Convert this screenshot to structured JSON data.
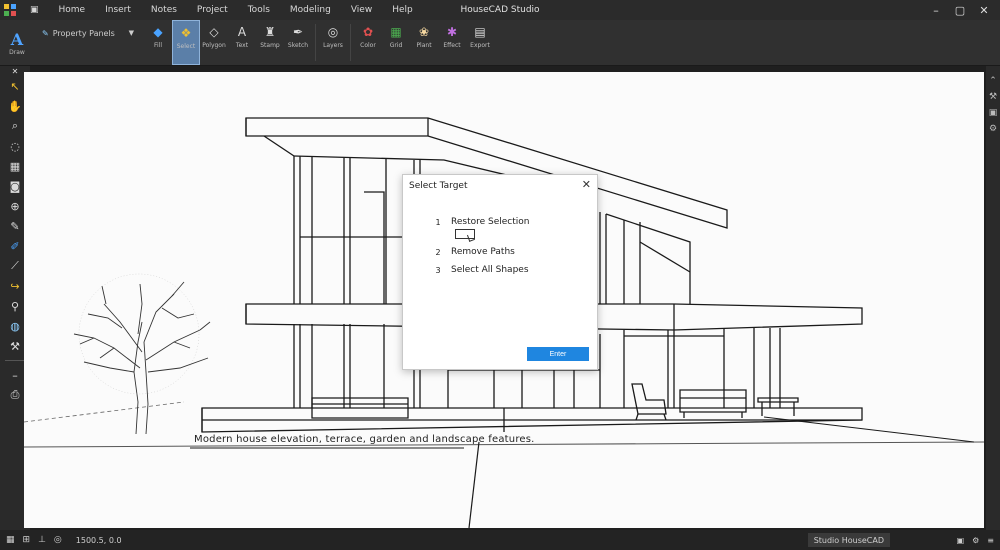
{
  "titlebar": {
    "title": "HouseCAD Studio",
    "menus": [
      "Home",
      "Insert",
      "Notes",
      "Project",
      "Tools",
      "Modeling",
      "View",
      "Help"
    ]
  },
  "ribbon": {
    "left_label": "Draw",
    "dropdown_label": "Property Panels",
    "tools": [
      {
        "icon": "paint-bucket-icon",
        "label": "Fill"
      },
      {
        "icon": "select-icon",
        "label": "Select"
      },
      {
        "icon": "diamond-icon",
        "label": "Polygon"
      },
      {
        "icon": "text-icon",
        "label": "Text"
      },
      {
        "icon": "stamp-icon",
        "label": "Stamp"
      },
      {
        "icon": "pen-icon",
        "label": "Sketch"
      },
      {
        "icon": "layers-icon",
        "label": "Layers"
      },
      {
        "icon": "palette-icon",
        "label": "Color"
      },
      {
        "icon": "grid-icon",
        "label": "Grid"
      },
      {
        "icon": "flower-icon",
        "label": "Plant"
      },
      {
        "icon": "star-icon",
        "label": "Effect"
      },
      {
        "icon": "clipboard-icon",
        "label": "Export"
      }
    ]
  },
  "dialog": {
    "title": "Select Target",
    "options": [
      {
        "num": "1",
        "label": "Restore Selection"
      },
      {
        "num": "2",
        "label": "Remove Paths"
      },
      {
        "num": "3",
        "label": "Select All Shapes"
      }
    ],
    "confirm_label": "Enter"
  },
  "canvas": {
    "caption": "Modern house elevation, terrace, garden and landscape features."
  },
  "statusbar": {
    "coords": "1500.5, 0.0",
    "product": "Studio HouseCAD"
  },
  "colors": {
    "accent": "#1f86e0",
    "ribbon_active": "#5b7fa8",
    "canvas_bg": "#fbfbfb"
  }
}
